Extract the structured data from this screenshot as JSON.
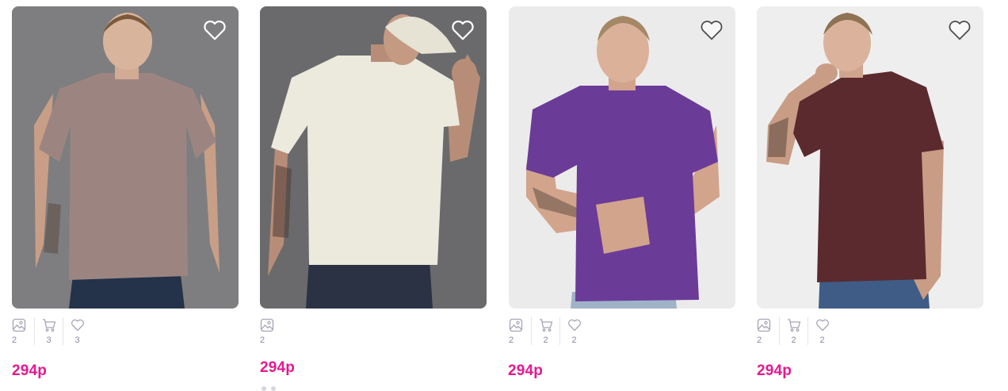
{
  "products": [
    {
      "price": "294р",
      "shirt_color": "#9c8581",
      "background_color": "#7e7e80",
      "stats": [
        {
          "icon": "image-icon",
          "count": "2"
        },
        {
          "icon": "cart-icon",
          "count": "3"
        },
        {
          "icon": "heart-icon",
          "count": "3"
        }
      ]
    },
    {
      "price": "294р",
      "shirt_color": "#ece9dd",
      "background_color": "#6a6a6c",
      "stats": [
        {
          "icon": "image-icon",
          "count": "2"
        }
      ]
    },
    {
      "price": "294р",
      "shirt_color": "#6b3b98",
      "background_color": "#ecebeb",
      "stats": [
        {
          "icon": "image-icon",
          "count": "2"
        },
        {
          "icon": "cart-icon",
          "count": "2"
        },
        {
          "icon": "heart-icon",
          "count": "2"
        }
      ]
    },
    {
      "price": "294р",
      "shirt_color": "#5a2a2e",
      "background_color": "#eeeeee",
      "stats": [
        {
          "icon": "image-icon",
          "count": "2"
        },
        {
          "icon": "cart-icon",
          "count": "2"
        },
        {
          "icon": "heart-icon",
          "count": "2"
        }
      ]
    }
  ],
  "theme": {
    "price_color": "#e5198f",
    "stat_icon_color": "#a4a4b8"
  }
}
